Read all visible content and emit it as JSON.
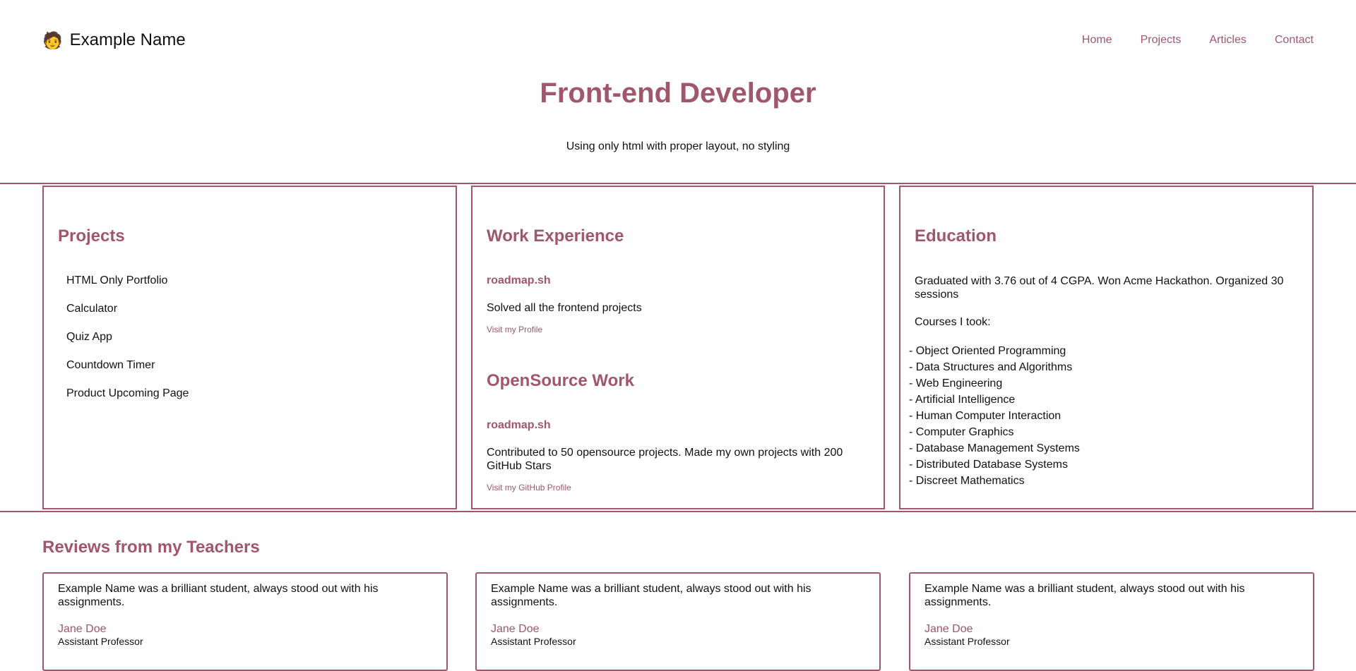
{
  "brand": {
    "emoji": "🧑",
    "name": "Example Name"
  },
  "nav": {
    "home": "Home",
    "projects": "Projects",
    "articles": "Articles",
    "contact": "Contact"
  },
  "hero": {
    "title": "Front-end Developer",
    "subtitle": "Using only html with proper layout, no styling"
  },
  "projects": {
    "heading": "Projects",
    "items": [
      "HTML Only Portfolio",
      "Calculator",
      "Quiz App",
      "Countdown Timer",
      "Product Upcoming Page"
    ]
  },
  "work": {
    "heading": "Work Experience",
    "org": "roadmap.sh",
    "desc": "Solved all the frontend projects",
    "link": "Visit my Profile"
  },
  "opensource": {
    "heading": "OpenSource Work",
    "org": "roadmap.sh",
    "desc": "Contributed to 50 opensource projects. Made my own projects with 200 GitHub Stars",
    "link": "Visit my GitHub Profile"
  },
  "education": {
    "heading": "Education",
    "summary": "Graduated with 3.76 out of 4 CGPA. Won Acme Hackathon. Organized 30 sessions",
    "courses_label": "Courses I took:",
    "courses": [
      "- Object Oriented Programming",
      "- Data Structures and Algorithms",
      "- Web Engineering",
      "- Artificial Intelligence",
      "- Human Computer Interaction",
      "- Computer Graphics",
      "- Database Management Systems",
      "- Distributed Database Systems",
      "- Discreet Mathematics"
    ]
  },
  "reviews": {
    "heading": "Reviews from my Teachers",
    "items": [
      {
        "text": "Example Name was a brilliant student, always stood out with his assignments.",
        "name": "Jane Doe",
        "role": "Assistant Professor"
      },
      {
        "text": "Example Name was a brilliant student, always stood out with his assignments.",
        "name": "Jane Doe",
        "role": "Assistant Professor"
      },
      {
        "text": "Example Name was a brilliant student, always stood out with his assignments.",
        "name": "Jane Doe",
        "role": "Assistant Professor"
      }
    ]
  },
  "colors": {
    "accent": "#a0566b",
    "text": "#111111",
    "background": "#ffffff"
  }
}
